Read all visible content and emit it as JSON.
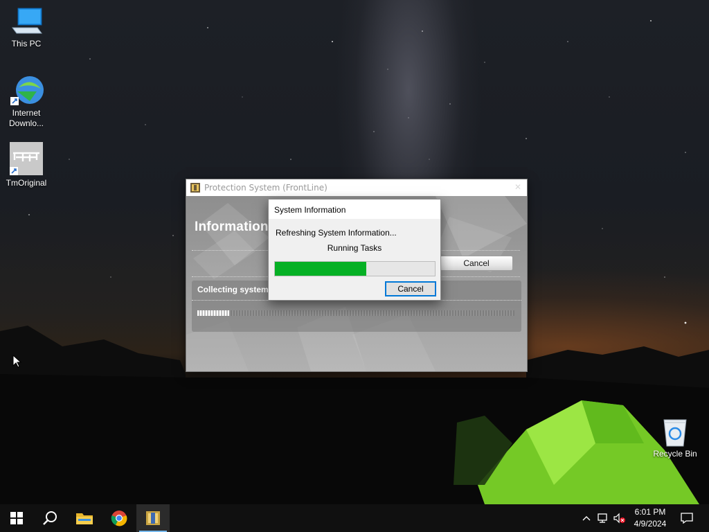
{
  "desktop": {
    "icons": [
      {
        "label": "This PC"
      },
      {
        "label": "Internet Downlo..."
      },
      {
        "label": "TmOriginal"
      },
      {
        "label": "Recycle Bin"
      }
    ]
  },
  "app_window": {
    "title": "Protection System (FrontLine)",
    "heading": "Information",
    "cancel_label": "Cancel",
    "collect_text": "Collecting system",
    "close_glyph": "✕",
    "marquee_progress_fraction": 0.1
  },
  "dialog": {
    "title": "System Information",
    "status": "Refreshing System Information...",
    "task": "Running Tasks",
    "progress_fraction": 0.57,
    "progress_color": "#06b025",
    "cancel_label": "Cancel"
  },
  "taskbar": {
    "start_icon": "windows-start-icon",
    "search_icon": "search-icon",
    "pinned": [
      {
        "name": "file-explorer-icon"
      },
      {
        "name": "chrome-icon"
      },
      {
        "name": "protection-system-icon",
        "active": true
      }
    ],
    "tray_icons": [
      "chevron-up-icon",
      "network-icon",
      "volume-muted-icon"
    ],
    "clock": {
      "time": "6:01 PM",
      "date": "4/9/2024"
    },
    "notification_icon": "action-center-icon"
  },
  "colors": {
    "accent": "#0078d7",
    "taskbar": "#101010",
    "active_indicator": "#76b9ed"
  }
}
